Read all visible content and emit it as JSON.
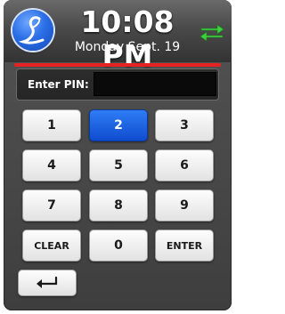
{
  "header": {
    "time": "10:08 PM",
    "date": "Monday Sept. 19",
    "logo_icon": "script-l-logo-icon",
    "sync_icon": "sync-arrows-icon",
    "accent_color": "#e62222"
  },
  "pin": {
    "label": "Enter PIN:",
    "value": ""
  },
  "keypad": {
    "k1": "1",
    "k2": "2",
    "k3": "3",
    "k4": "4",
    "k5": "5",
    "k6": "6",
    "k7": "7",
    "k8": "8",
    "k9": "9",
    "clear": "CLEAR",
    "k0": "0",
    "enter": "ENTER",
    "active_key": "2",
    "active_color": "#1a5fe0"
  },
  "back_button": {
    "icon": "return-arrow-icon"
  }
}
